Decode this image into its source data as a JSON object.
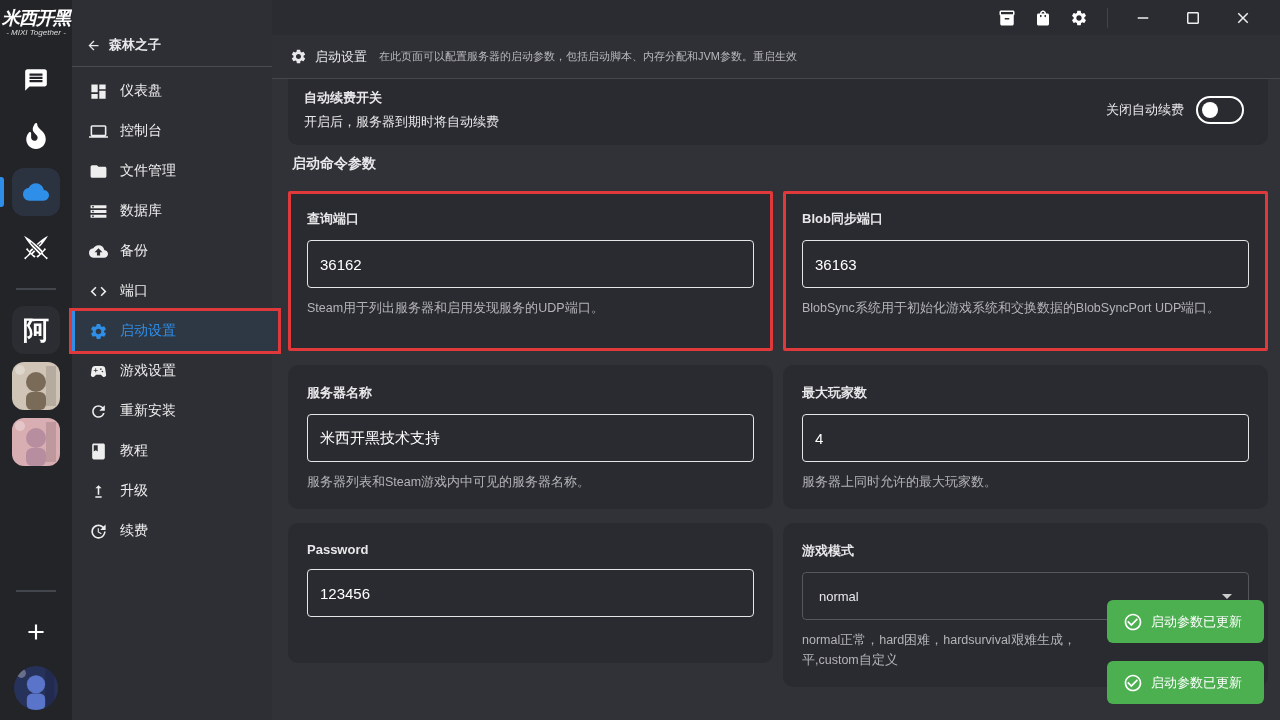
{
  "logo": {
    "title": "米西开黑",
    "tagline": "- MIXI Together -"
  },
  "rail": {
    "top_items": [
      {
        "kind": "icon",
        "selected": false
      },
      {
        "kind": "icon",
        "selected": false
      },
      {
        "kind": "icon",
        "selected": true
      },
      {
        "kind": "icon",
        "selected": false
      }
    ],
    "servers": [
      {
        "kind": "text",
        "label": "阿"
      },
      {
        "kind": "picture"
      },
      {
        "kind": "picture"
      }
    ]
  },
  "nav": {
    "back_title": "森林之子",
    "items": [
      {
        "label": "仪表盘",
        "selected": false,
        "highlighted": false
      },
      {
        "label": "控制台",
        "selected": false,
        "highlighted": false
      },
      {
        "label": "文件管理",
        "selected": false,
        "highlighted": false
      },
      {
        "label": "数据库",
        "selected": false,
        "highlighted": false
      },
      {
        "label": "备份",
        "selected": false,
        "highlighted": false
      },
      {
        "label": "端口",
        "selected": false,
        "highlighted": false
      },
      {
        "label": "启动设置",
        "selected": true,
        "highlighted": true
      },
      {
        "label": "游戏设置",
        "selected": false,
        "highlighted": false
      },
      {
        "label": "重新安装",
        "selected": false,
        "highlighted": false
      },
      {
        "label": "教程",
        "selected": false,
        "highlighted": false
      },
      {
        "label": "升级",
        "selected": false,
        "highlighted": false
      },
      {
        "label": "续费",
        "selected": false,
        "highlighted": false
      }
    ]
  },
  "header": {
    "title": "启动设置",
    "subtitle": "在此页面可以配置服务器的启动参数，包括启动脚本、内存分配和JVM参数。重启生效"
  },
  "auto_renew": {
    "title": "自动续费开关",
    "description": "开启后，服务器到期时将自动续费",
    "toggle_label": "关闭自动续费",
    "on": false
  },
  "section_title": "启动命令参数",
  "params": [
    {
      "kind": "input",
      "label": "查询端口",
      "value": "36162",
      "description": [
        "Steam用于列出服务器和启用发现服务的UDP端口。"
      ],
      "highlighted": true
    },
    {
      "kind": "input",
      "label": "Blob同步端口",
      "value": "36163",
      "description": [
        "BlobSync系统用于初始化游戏系统和交换数据的BlobSyncPort UDP端口。"
      ],
      "highlighted": true
    },
    {
      "kind": "input",
      "label": "服务器名称",
      "value": "米西开黑技术支持",
      "description": [
        "服务器列表和Steam游戏内中可见的服务器名称。"
      ],
      "highlighted": false
    },
    {
      "kind": "input",
      "label": "最大玩家数",
      "value": "4",
      "description": [
        "服务器上同时允许的最大玩家数。"
      ],
      "highlighted": false
    },
    {
      "kind": "input",
      "label": "Password",
      "value": "123456",
      "highlighted": false
    },
    {
      "kind": "select",
      "label": "游戏模式",
      "value": "normal",
      "description": [
        "normal正常，hard困难，hardsurvival艰难生成，",
        "平,custom自定义"
      ],
      "highlighted": false
    }
  ],
  "toasts": [
    {
      "text": "启动参数已更新"
    },
    {
      "text": "启动参数已更新"
    }
  ]
}
